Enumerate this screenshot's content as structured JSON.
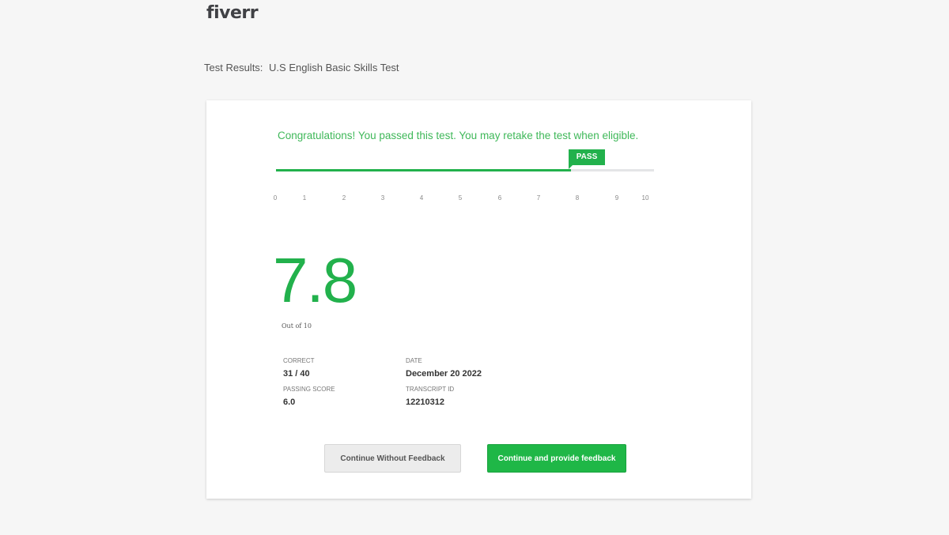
{
  "brand": {
    "logo_text": "fiverr"
  },
  "header": {
    "label": "Test Results:",
    "test_name": "U.S English Basic Skills Test"
  },
  "result": {
    "message": "Congratulations! You passed this test. You may retake the test when eligible.",
    "badge": "PASS",
    "score": "7.8",
    "score_value": 7.8,
    "score_max": 10,
    "out_of": "Out of 10",
    "scale_ticks": [
      "0",
      "1",
      "2",
      "3",
      "4",
      "5",
      "6",
      "7",
      "8",
      "9",
      "10"
    ]
  },
  "stats": {
    "correct_label": "CORRECT",
    "correct_value": "31 / 40",
    "date_label": "DATE",
    "date_value": "December 20 2022",
    "passing_label": "PASSING SCORE",
    "passing_value": "6.0",
    "transcript_label": "TRANSCRIPT ID",
    "transcript_value": "12210312"
  },
  "actions": {
    "secondary_label": "Continue Without Feedback",
    "primary_label": "Continue and provide feedback"
  },
  "colors": {
    "accent_green": "#22b14c",
    "background": "#f6f6f6"
  }
}
